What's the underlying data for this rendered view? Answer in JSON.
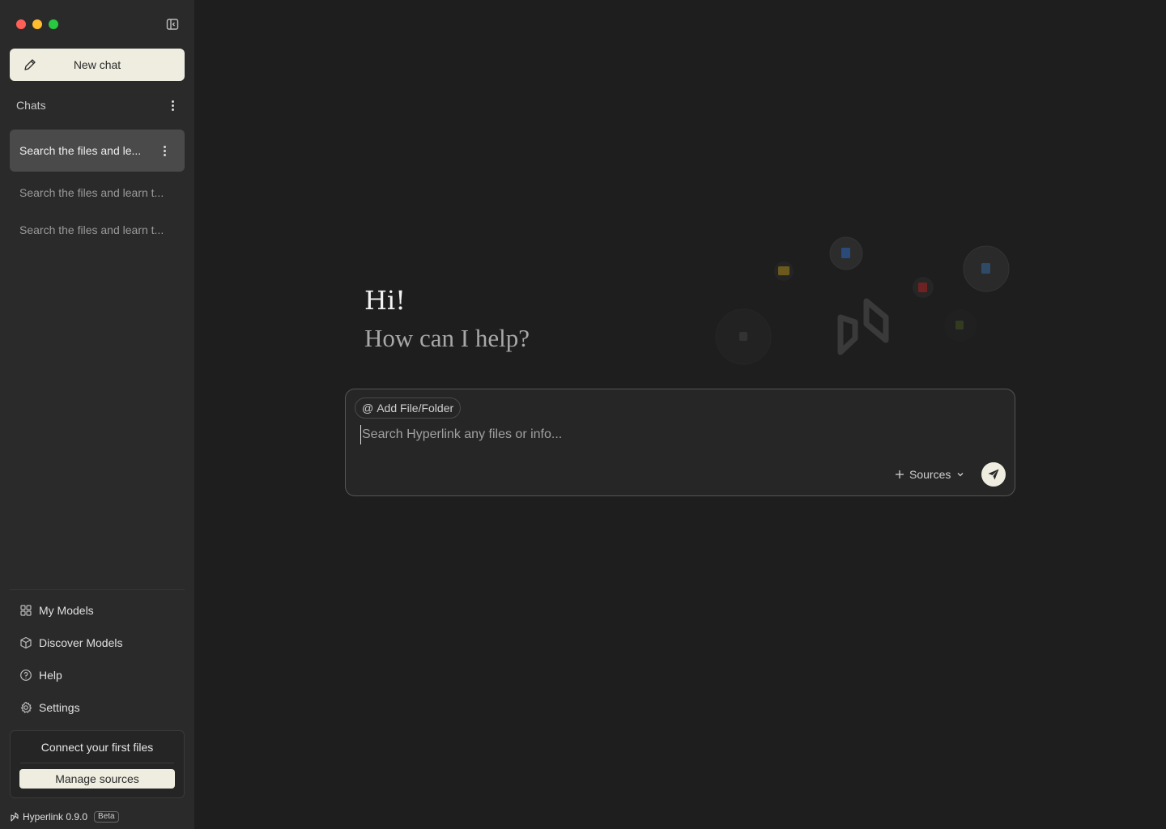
{
  "window": {
    "controls": [
      "close",
      "minimize",
      "zoom"
    ]
  },
  "sidebar": {
    "new_chat_label": "New chat",
    "chats_heading": "Chats",
    "chats": [
      {
        "title": "Search the files and le...",
        "active": true
      },
      {
        "title": "Search the files and learn t...",
        "active": false
      },
      {
        "title": "Search the files and learn t...",
        "active": false
      }
    ],
    "nav": [
      {
        "label": "My Models",
        "icon": "grid-icon"
      },
      {
        "label": "Discover Models",
        "icon": "cube-icon"
      },
      {
        "label": "Help",
        "icon": "help-circle-icon"
      },
      {
        "label": "Settings",
        "icon": "gear-icon"
      }
    ],
    "connect_card": {
      "title": "Connect your first files",
      "button_label": "Manage sources"
    },
    "footer": {
      "app_name": "Hyperlink 0.9.0",
      "badge": "Beta"
    }
  },
  "main": {
    "greeting": "Hi!",
    "subgreeting": "How can I help?",
    "composer": {
      "add_label": "Add File/Folder",
      "add_prefix": "@",
      "placeholder": "Search Hyperlink any files or info...",
      "sources_label": "Sources"
    }
  },
  "colors": {
    "background": "#1e1e1e",
    "sidebar": "#2a2a2a",
    "accent_cream": "#efede0"
  }
}
